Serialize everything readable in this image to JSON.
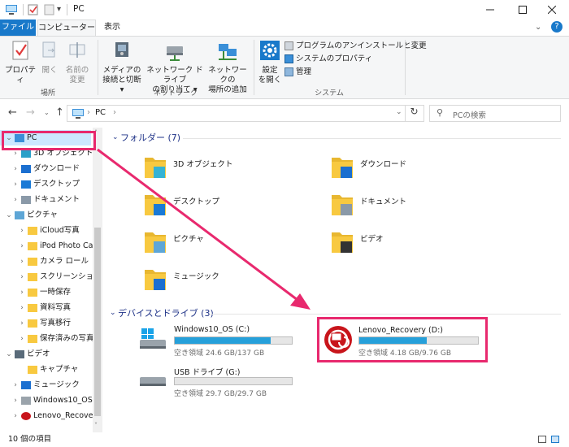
{
  "window": {
    "title": "PC"
  },
  "ribbon": {
    "tabs": [
      {
        "label": "ファイル"
      },
      {
        "label": "コンピューター"
      },
      {
        "label": "表示"
      }
    ],
    "location": {
      "properties": "プロパティ",
      "open": "開く",
      "rename1": "名前の",
      "rename2": "変更",
      "group": "場所"
    },
    "network": {
      "media1": "メディアの",
      "media2": "接続と切断",
      "map1": "ネットワーク ドライブ",
      "map2": "の割り当て",
      "add1": "ネットワークの",
      "add2": "場所の追加",
      "group": "ネットワーク"
    },
    "system": {
      "settings1": "設定",
      "settings2": "を開く",
      "uninstall": "プログラムのアンインストールと変更",
      "sysprops": "システムのプロパティ",
      "manage": "管理",
      "group": "システム"
    }
  },
  "address": {
    "path": "PC",
    "separator": "›",
    "search_placeholder": "PCの検索"
  },
  "nav": {
    "items": [
      {
        "label": "PC",
        "chev": "⌄",
        "icon": "pc-icon"
      },
      {
        "label": "3D オブジェクト",
        "chev": "›",
        "icon": "3d-objects-icon"
      },
      {
        "label": "ダウンロード",
        "chev": "›",
        "icon": "download-icon"
      },
      {
        "label": "デスクトップ",
        "chev": "›",
        "icon": "desktop-icon"
      },
      {
        "label": "ドキュメント",
        "chev": "›",
        "icon": "documents-icon"
      },
      {
        "label": "ピクチャ",
        "chev": "⌄",
        "icon": "pictures-icon"
      },
      {
        "label": "iCloud写真",
        "chev": "›",
        "icon": "folder-icon"
      },
      {
        "label": "iPod Photo Cac",
        "chev": "›",
        "icon": "folder-icon"
      },
      {
        "label": "カメラ ロール",
        "chev": "›",
        "icon": "folder-icon"
      },
      {
        "label": "スクリーンショット",
        "chev": "›",
        "icon": "folder-icon"
      },
      {
        "label": "一時保存",
        "chev": "›",
        "icon": "folder-icon"
      },
      {
        "label": "資料写真",
        "chev": "›",
        "icon": "folder-icon"
      },
      {
        "label": "写真移行",
        "chev": "›",
        "icon": "folder-icon"
      },
      {
        "label": "保存済みの写真",
        "chev": "›",
        "icon": "folder-icon"
      },
      {
        "label": "ビデオ",
        "chev": "⌄",
        "icon": "videos-icon"
      },
      {
        "label": "キャプチャ",
        "chev": "",
        "icon": "folder-icon"
      },
      {
        "label": "ミュージック",
        "chev": "›",
        "icon": "music-icon"
      },
      {
        "label": "Windows10_OS (",
        "chev": "›",
        "icon": "drive-icon"
      },
      {
        "label": "Lenovo_Recover",
        "chev": "›",
        "icon": "lenovo-recovery-icon"
      }
    ]
  },
  "folders": {
    "heading": "フォルダー (7)",
    "items": [
      {
        "label": "3D オブジェクト"
      },
      {
        "label": "ダウンロード"
      },
      {
        "label": "デスクトップ"
      },
      {
        "label": "ドキュメント"
      },
      {
        "label": "ピクチャ"
      },
      {
        "label": "ビデオ"
      },
      {
        "label": "ミュージック"
      }
    ]
  },
  "drives": {
    "heading": "デバイスとドライブ (3)",
    "items": [
      {
        "label": "Windows10_OS (C:)",
        "free": "空き領域 24.6 GB/137 GB",
        "used_fraction": 0.82
      },
      {
        "label": "Lenovo_Recovery (D:)",
        "free": "空き領域 4.18 GB/9.76 GB",
        "used_fraction": 0.57
      },
      {
        "label": "USB ドライブ (G:)",
        "free": "空き領域 29.7 GB/29.7 GB",
        "used_fraction": 0.0
      }
    ]
  },
  "status": {
    "count": "10 個の項目"
  },
  "colors": {
    "accent": "#1979ca",
    "highlight": "#e8296e",
    "bar": "#26a0da",
    "folder": "#f8c940"
  }
}
